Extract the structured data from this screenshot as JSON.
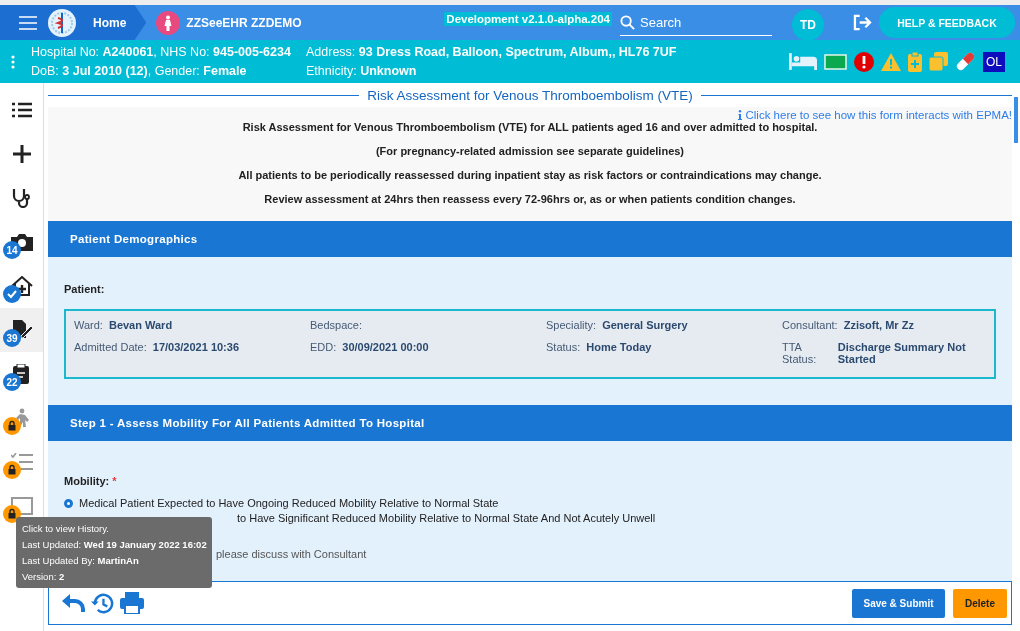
{
  "topbar": {
    "home": "Home",
    "app_name": "ZZSeeEHR ZZDEMO",
    "version": "Development v2.1.0-alpha.204",
    "search": {
      "placeholder": "Search"
    },
    "user_initials": "TD",
    "help_button": "HELP & FEEDBACK"
  },
  "patient_banner": {
    "line1_left": "Hospital No: **A240061**, NHS No: **945-005-6234**",
    "line1_right": "Address: **93 Dress Road, Balloon, Spectrum, Album,, HL76 7UF**",
    "line2_left": "DoB: **3 Jul 2010 (12)**, Gender: **Female**",
    "line2_right": "Ethnicity: **Unknown**",
    "alerts": [
      {
        "kind": "bed"
      },
      {
        "kind": "flag"
      },
      {
        "kind": "error"
      },
      {
        "kind": "warning"
      },
      {
        "kind": "clipboard"
      },
      {
        "kind": "copy"
      },
      {
        "kind": "pill"
      },
      {
        "kind": "text",
        "label": "OL"
      }
    ]
  },
  "sidebar": {
    "items": [
      {
        "selected": false
      },
      {
        "selected": false
      },
      {
        "selected": false
      },
      {
        "selected": false,
        "badge": {
          "kind": "count",
          "text": "14"
        }
      },
      {
        "selected": false,
        "badge": {
          "kind": "check"
        }
      },
      {
        "selected": true,
        "badge": {
          "kind": "count",
          "text": "39"
        }
      },
      {
        "selected": false,
        "badge": {
          "kind": "count",
          "text": "22"
        }
      },
      {
        "selected": false,
        "badge": {
          "kind": "lock"
        }
      },
      {
        "selected": false,
        "badge": {
          "kind": "lock"
        }
      },
      {
        "selected": false,
        "badge": {
          "kind": "lock"
        }
      }
    ]
  },
  "form": {
    "title": "Risk Assessment for Venous Thromboembolism (VTE)",
    "info_link": "Click here to see how this form interacts with EPMA!",
    "intro": [
      "Risk Assessment for Venous Thromboembolism (VTE) for ALL patients aged 16 and over admitted to hospital.",
      "(For pregnancy-related admission see separate guidelines)",
      "All patients to be periodically reassessed during inpatient stay as risk factors or contraindications may change.",
      "Review assessment at 24hrs then reassess every 72-96hrs or, as or when patients condition changes."
    ],
    "demographics": {
      "heading": "Patient Demographics",
      "label": "Patient:",
      "fields": [
        {
          "label": "Ward:",
          "value": "Bevan Ward"
        },
        {
          "label": "Bedspace:"
        },
        {
          "label": "Speciality:",
          "value": "General Surgery"
        },
        {
          "label": "Consultant:",
          "value": "Zzisoft, Mr Zz"
        },
        {
          "label": "Admitted Date:",
          "value": "17/03/2021 10:36"
        },
        {
          "label": "EDD:",
          "value": "30/09/2021 00:00"
        },
        {
          "label": "Status:",
          "value": "Home Today"
        },
        {
          "label": "TTA Status:",
          "value": "Discharge Summary Not Started"
        }
      ]
    },
    "step1": {
      "heading": "Step 1 - Assess Mobility For All Patients Admitted To Hospital",
      "question": "Mobility:",
      "required_mark": "*",
      "options": [
        {
          "kind": "radio",
          "label": "Medical Patient Expected to Have Ongoing Reduced Mobility Relative to Normal State",
          "selected": true
        },
        {
          "kind": "covered",
          "label": "to Have Significant Reduced Mobility Relative to Normal State And Not Acutely Unwell"
        }
      ],
      "note": "please discuss with Consultant"
    }
  },
  "tooltip": {
    "line1": "Click to view History.",
    "line2": "Last Updated: **Wed 19 January 2022 16:02**",
    "line3": "Last Updated By: **MartinAn**",
    "line4": "Version: **2**"
  },
  "actions": {
    "save": "Save & Submit",
    "delete": "Delete"
  }
}
